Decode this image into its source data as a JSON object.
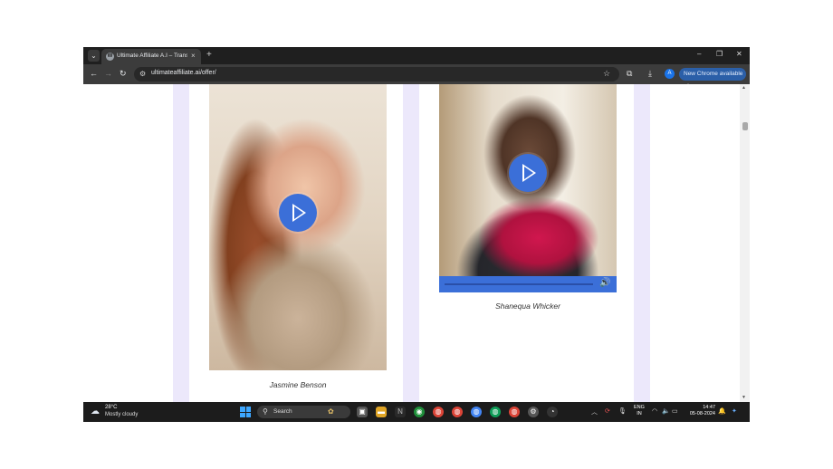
{
  "browser": {
    "tab_title": "Ultimate Affiliate A.I – Transform",
    "tab_close": "×",
    "new_tab": "+",
    "url": "ultimateaffiliate.ai/offer/",
    "update_button": "New Chrome available",
    "avatar_letter": "A",
    "window_controls": {
      "minimize": "–",
      "restore": "❐",
      "close": "✕"
    }
  },
  "testimonials": [
    {
      "name": "Jasmine Benson"
    },
    {
      "name": "Shanequa Whicker"
    }
  ],
  "taskbar": {
    "temperature": "28°C",
    "weather": "Mostly cloudy",
    "search_placeholder": "Search",
    "language_line1": "ENG",
    "language_line2": "IN",
    "time": "14:47",
    "date": "05-08-2024"
  },
  "icons": [
    "tab-search-icon",
    "wordpress-favicon",
    "back-icon",
    "forward-icon",
    "reload-icon",
    "site-info-icon",
    "bookmark-star-icon",
    "extensions-icon",
    "download-icon",
    "play-icon",
    "volume-icon",
    "weather-cloud-icon",
    "windows-start-icon",
    "search-icon",
    "wifi-icon",
    "speaker-icon",
    "battery-icon"
  ],
  "colors": {
    "accent_blue": "#3b6fd8",
    "lavender": "#ece8fb",
    "chrome_dark": "#1f1f1f"
  }
}
